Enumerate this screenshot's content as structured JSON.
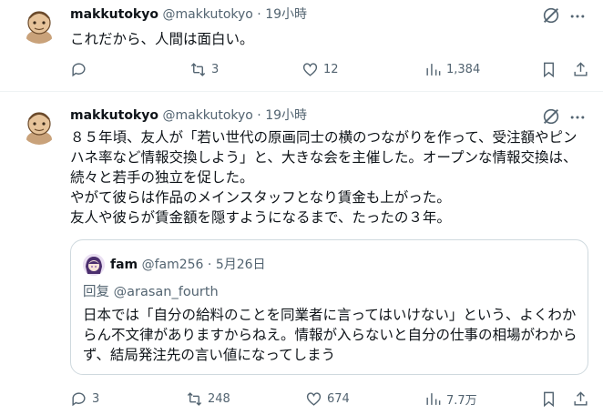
{
  "tweets": [
    {
      "name": "makkutokyo",
      "handle": "@makkutokyo",
      "time": "19小時",
      "text": "これだから、人間は面白い。",
      "actions": {
        "reply": "",
        "retweet": "3",
        "like": "12",
        "views": "1,384"
      }
    },
    {
      "name": "makkutokyo",
      "handle": "@makkutokyo",
      "time": "19小時",
      "text": "８５年頃、友人が「若い世代の原画同士の横のつながりを作って、受注額やピンハネ率など情報交換しよう」と、大きな会を主催した。オープンな情報交換は、続々と若手の独立を促した。\nやがて彼らは作品のメインスタッフとなり賃金も上がった。\n友人や彼らが賃金額を隠すようになるまで、たったの３年。",
      "actions": {
        "reply": "3",
        "retweet": "248",
        "like": "674",
        "views": "7.7万"
      },
      "quote": {
        "name": "fam",
        "handle": "@fam256",
        "date": "5月26日",
        "reply_label": "回复",
        "reply_handle": "@arasan_fourth",
        "text": "日本では「自分の給料のことを同業者に言ってはいけない」という、よくわからん不文律がありますからねえ。情報が入らないと自分の仕事の相場がわからず、結局発注先の言い値になってしまう"
      }
    }
  ],
  "separator": "·",
  "icons": {
    "reply": "reply-icon",
    "retweet": "retweet-icon",
    "like": "heart-icon",
    "views": "views-icon",
    "bookmark": "bookmark-icon",
    "share": "share-icon",
    "grok": "grok-icon",
    "more": "more-icon"
  },
  "colors": {
    "text": "#0f1419",
    "muted": "#536471",
    "border": "#cfd9de",
    "divider": "#eff3f4"
  }
}
